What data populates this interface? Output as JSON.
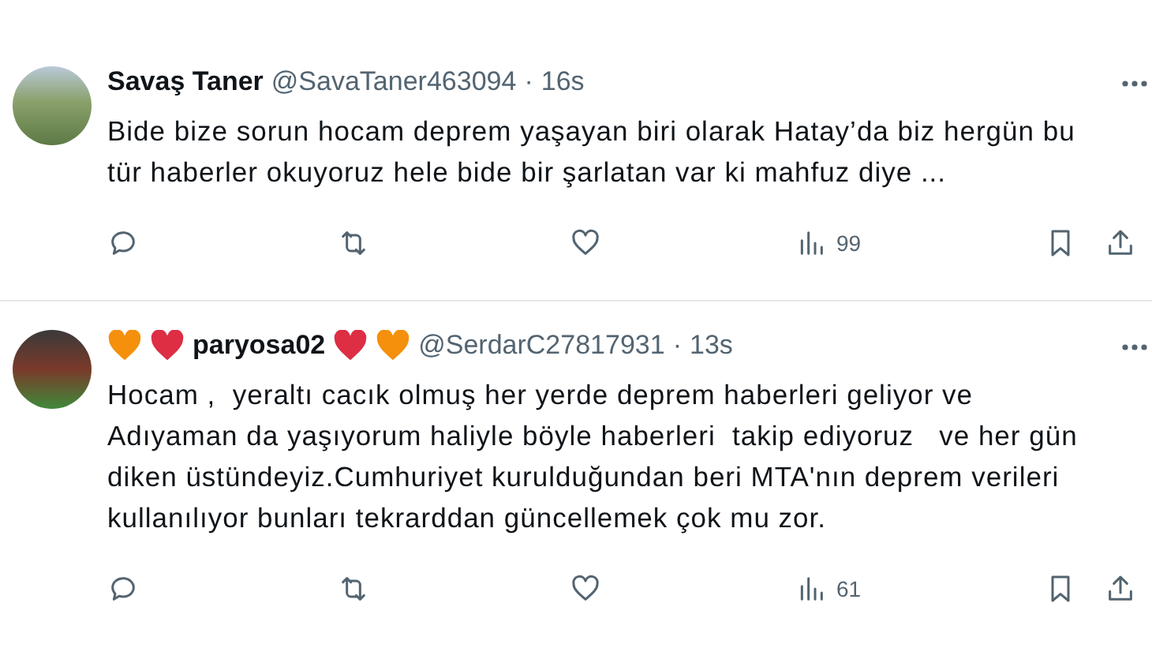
{
  "tweets": [
    {
      "avatar": {
        "kind": "landscape"
      },
      "name": "Savaş Taner",
      "handle": "@SavaTaner463094",
      "separator": "·",
      "time": "16s",
      "text": "Bide bize sorun hocam deprem yaşayan biri olarak Hatay’da biz hergün bu\ntür haberler okuyoruz hele bide bir şarlatan var ki mahfuz diye ...",
      "views": "99"
    },
    {
      "avatar": {
        "kind": "person"
      },
      "name": "paryosa02",
      "hearts_before": [
        {
          "color": "#f4900c"
        },
        {
          "color": "#dd2e44"
        }
      ],
      "hearts_after": [
        {
          "color": "#dd2e44"
        },
        {
          "color": "#f4900c"
        }
      ],
      "handle": "@SerdarC27817931",
      "separator": "·",
      "time": "13s",
      "text": "Hocam ,  yeraltı cacık olmuş her yerde deprem haberleri geliyor ve\nAdıyaman da yaşıyorum haliyle böyle haberleri  takip ediyoruz   ve her gün\ndiken üstündeyiz.Cumhuriyet kurulduğundan beri MTA'nın deprem verileri\nkullanılıyor bunları tekrarddan güncellemek çok mu zor.",
      "views": "61"
    }
  ]
}
